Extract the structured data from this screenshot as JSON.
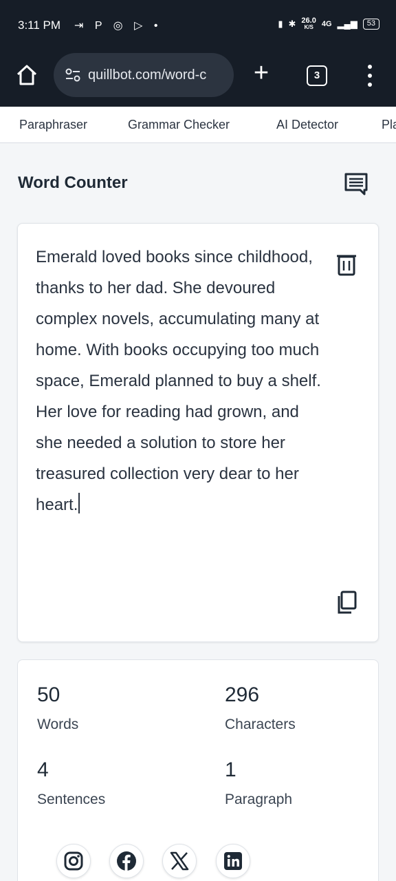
{
  "status_bar": {
    "time": "3:11 PM",
    "app_icons": "⇥ P ◎ ▷ •",
    "net_speed": "26.0",
    "net_speed_unit": "K/S",
    "network": "4G",
    "battery": "53"
  },
  "browser": {
    "url": "quillbot.com/word-c",
    "tab_count": "3"
  },
  "nav": {
    "items": [
      "Paraphraser",
      "Grammar Checker",
      "AI Detector",
      "Pla"
    ]
  },
  "page": {
    "title": "Word Counter"
  },
  "editor": {
    "text": "Emerald loved books since childhood, thanks to her dad. She devoured complex novels, accumulating many at home. With books occupying too much space, Emerald planned to buy a shelf. Her love for reading had grown, and she needed a solution to store her treasured collection very dear to her heart."
  },
  "stats": {
    "words": {
      "value": "50",
      "label": "Words"
    },
    "characters": {
      "value": "296",
      "label": "Characters"
    },
    "sentences": {
      "value": "4",
      "label": "Sentences"
    },
    "paragraphs": {
      "value": "1",
      "label": "Paragraph"
    }
  },
  "social": {
    "icons": [
      "instagram-icon",
      "facebook-icon",
      "x-icon",
      "linkedin-icon"
    ]
  },
  "colors": {
    "topbar": "#161d27",
    "url_pill": "#2c3440",
    "page_bg": "#f4f6f8",
    "text": "#1f2a36"
  }
}
